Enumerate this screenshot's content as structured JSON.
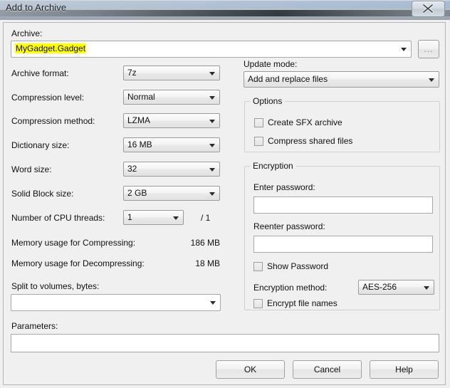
{
  "window": {
    "title": "Add to Archive",
    "close_icon": "close-icon"
  },
  "archive": {
    "label": "Archive:",
    "value": "MyGadget.Gadget",
    "browse_label": "...",
    "placeholder": ""
  },
  "left_panel": {
    "rows": [
      {
        "label": "Archive format:",
        "value": "7z"
      },
      {
        "label": "Compression level:",
        "value": "Normal"
      },
      {
        "label": "Compression method:",
        "value": "LZMA"
      },
      {
        "label": "Dictionary size:",
        "value": "16 MB"
      },
      {
        "label": "Word size:",
        "value": "32"
      },
      {
        "label": "Solid Block size:",
        "value": "2 GB"
      }
    ],
    "cpu_threads": {
      "label": "Number of CPU threads:",
      "value": "1",
      "max_text": "/ 1"
    },
    "memory_compress": {
      "label": "Memory usage for Compressing:",
      "value": "186 MB"
    },
    "memory_decompress": {
      "label": "Memory usage for Decompressing:",
      "value": "18 MB"
    },
    "split": {
      "label": "Split to volumes, bytes:",
      "value": "",
      "placeholder": ""
    }
  },
  "right_panel": {
    "update_mode": {
      "label": "Update mode:",
      "value": "Add and replace files"
    },
    "options": {
      "title": "Options",
      "checkboxes": [
        {
          "label": "Create SFX archive",
          "checked": false
        },
        {
          "label": "Compress shared files",
          "checked": false
        }
      ]
    },
    "encryption": {
      "title": "Encryption",
      "enter_password_label": "Enter password:",
      "enter_password_value": "",
      "reenter_password_label": "Reenter password:",
      "reenter_password_value": "",
      "show_password": {
        "label": "Show Password",
        "checked": false
      },
      "method_label": "Encryption method:",
      "method_value": "AES-256",
      "encrypt_file_names": {
        "label": "Encrypt file names",
        "checked": false
      }
    }
  },
  "parameters": {
    "label": "Parameters:",
    "value": "",
    "placeholder": ""
  },
  "buttons": {
    "ok": "OK",
    "cancel": "Cancel",
    "help": "Help"
  },
  "colors": {
    "dialog_background": "#f0f0f0",
    "highlight": "#ffff00",
    "field_background": "#ffffff",
    "text": "#101010"
  }
}
